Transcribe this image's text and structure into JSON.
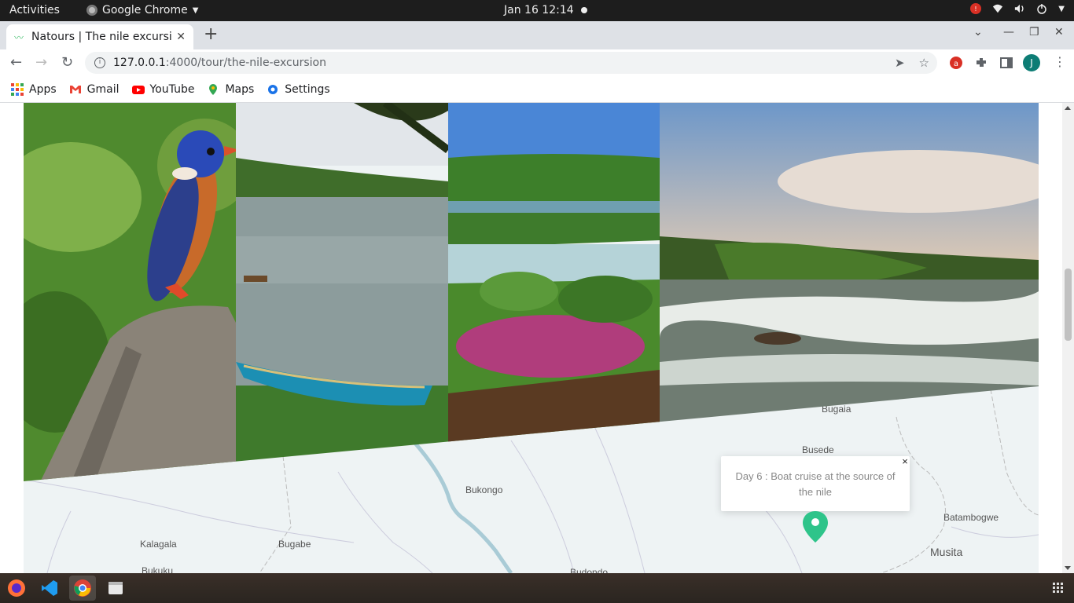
{
  "system_bar": {
    "activities": "Activities",
    "app_name": "Google Chrome",
    "clock": "Jan 16  12:14"
  },
  "browser": {
    "tab_title": "Natours | The nile excursion",
    "url_host": "127.0.0.1",
    "url_path": ":4000/tour/the-nile-excursion",
    "profile_initial": "J"
  },
  "bookmarks": [
    {
      "label": "Apps",
      "icon": "apps-grid-icon"
    },
    {
      "label": "Gmail",
      "icon": "gmail-icon"
    },
    {
      "label": "YouTube",
      "icon": "youtube-icon"
    },
    {
      "label": "Maps",
      "icon": "maps-pin-icon"
    },
    {
      "label": "Settings",
      "icon": "gear-icon"
    }
  ],
  "map": {
    "labels": [
      "Bugaia",
      "Busede",
      "Bukongo",
      "Batambogwe",
      "Kalagala",
      "Bugabe",
      "Musita",
      "Bukuku",
      "Budondo"
    ],
    "popup_text": "Day 6 : Boat cruise at the source of the nile",
    "popup_close": "×"
  },
  "colors": {
    "brand_green": "#55c57a",
    "marker_green": "#2ecc8f"
  }
}
